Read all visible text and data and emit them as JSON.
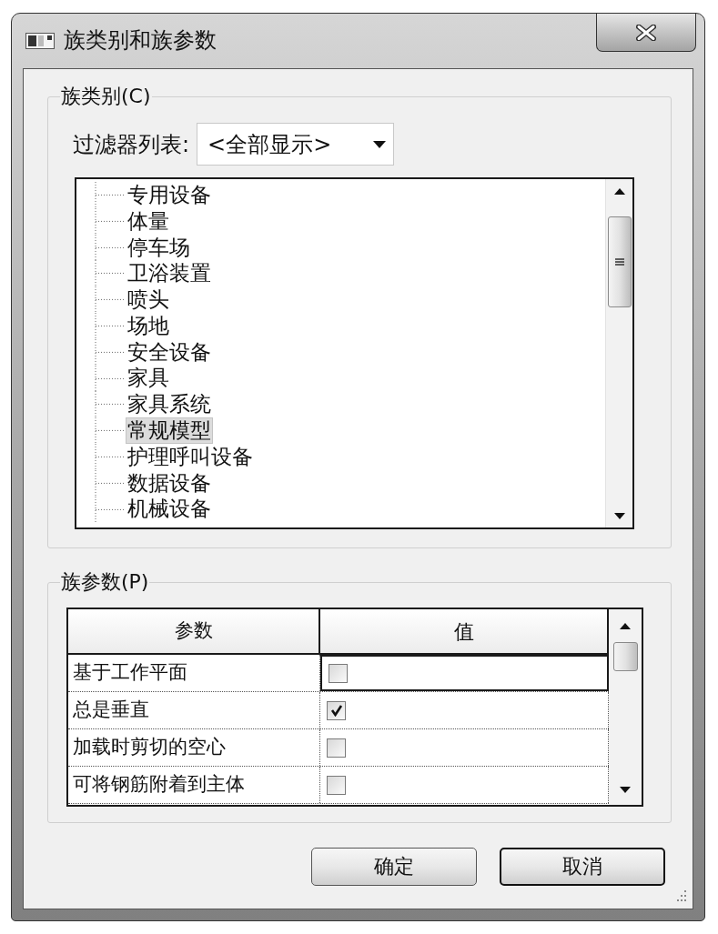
{
  "window": {
    "title": "族类别和族参数"
  },
  "family_category": {
    "legend": "族类别(C)",
    "filter": {
      "label": "过滤器列表:",
      "value": "<全部显示>"
    },
    "tree": {
      "items": [
        {
          "label": "专用设备",
          "selected": false
        },
        {
          "label": "体量",
          "selected": false
        },
        {
          "label": "停车场",
          "selected": false
        },
        {
          "label": "卫浴装置",
          "selected": false
        },
        {
          "label": "喷头",
          "selected": false
        },
        {
          "label": "场地",
          "selected": false
        },
        {
          "label": "安全设备",
          "selected": false
        },
        {
          "label": "家具",
          "selected": false
        },
        {
          "label": "家具系统",
          "selected": false
        },
        {
          "label": "常规模型",
          "selected": true
        },
        {
          "label": "护理呼叫设备",
          "selected": false
        },
        {
          "label": "数据设备",
          "selected": false
        },
        {
          "label": "机械设备",
          "selected": false
        }
      ]
    }
  },
  "family_parameters": {
    "legend": "族参数(P)",
    "table": {
      "columns": [
        "参数",
        "值"
      ],
      "rows": [
        {
          "parameter": "基于工作平面",
          "checked": false,
          "focused": true
        },
        {
          "parameter": "总是垂直",
          "checked": true,
          "focused": false
        },
        {
          "parameter": "加载时剪切的空心",
          "checked": false,
          "focused": false
        },
        {
          "parameter": "可将钢筋附着到主体",
          "checked": false,
          "focused": false
        }
      ]
    }
  },
  "buttons": [
    {
      "label": "确定",
      "default": false
    },
    {
      "label": "取消",
      "default": true
    }
  ]
}
